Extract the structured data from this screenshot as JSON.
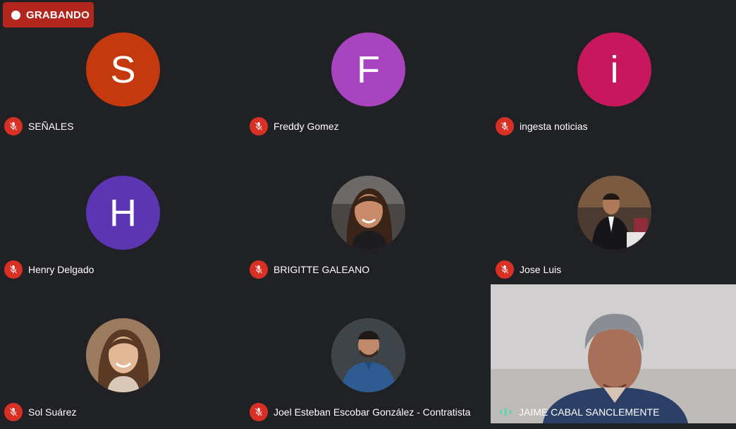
{
  "recording": {
    "label": "GRABANDO"
  },
  "participants": [
    {
      "name": "SEÑALES",
      "initial": "S",
      "color": "#c5390f"
    },
    {
      "name": "Freddy Gomez",
      "initial": "F",
      "color": "#a844c0"
    },
    {
      "name": "ingesta noticias",
      "initial": "i",
      "color": "#c8185d"
    },
    {
      "name": "Henry Delgado",
      "initial": "H",
      "color": "#5c35b3"
    },
    {
      "name": "BRIGITTE GALEANO"
    },
    {
      "name": "Jose Luis"
    },
    {
      "name": "Sol Suárez"
    },
    {
      "name": "Joel Esteban Escobar González - Contratista"
    },
    {
      "name": "JAIME CABAL SANCLEMENTE"
    }
  ],
  "icons": {
    "muted": "mic-off-icon",
    "speaking": "audio-level-icon",
    "recording": "record-dot-icon"
  }
}
